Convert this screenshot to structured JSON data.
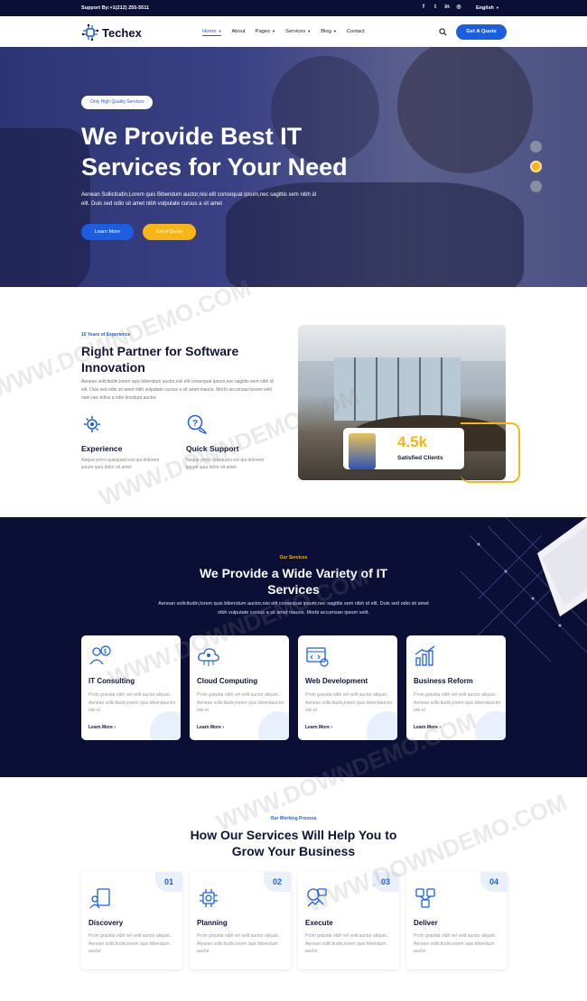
{
  "topbar": {
    "support": "Support By:+1(212) 255-5511",
    "social_icons": [
      "facebook-icon",
      "twitter-icon",
      "linkedin-icon",
      "instagram-icon"
    ],
    "language": "English"
  },
  "nav": {
    "logo_text": "Techex",
    "items": [
      {
        "label": "Home",
        "has_dropdown": true,
        "active": true
      },
      {
        "label": "About",
        "has_dropdown": false
      },
      {
        "label": "Pages",
        "has_dropdown": true
      },
      {
        "label": "Services",
        "has_dropdown": true
      },
      {
        "label": "Blog",
        "has_dropdown": true
      },
      {
        "label": "Contact",
        "has_dropdown": false
      }
    ],
    "cta": "Get A Quote"
  },
  "hero": {
    "badge": "Only High Quality Services",
    "title": "We Provide Best IT Services for Your Need",
    "text": "Aenean Sollicitudin,Lorem quis Bibendum auctor,nisi elit consequat ipsum,nec sagittis sem nibh id elit. Duis sed odio sit amet nibh vulputate cursus a sit amet",
    "btn_learn": "Learn More",
    "btn_quote": "Get A Quote",
    "slide_count": 3,
    "active_slide": 2
  },
  "about": {
    "tag": "15 Years of Experience",
    "title": "Right Partner for Software Innovation",
    "text": "Aenean solicitudin,lorem quis bibendum auctor,nisi elit consequat ipsum,nec sagittis sem nibh id elit. Duis sed odio sit amet nibh vulputate cursus a sit amet mauris. Morbi accumsan ipsum velit nam nec tellus a odio tincidunt auctor.",
    "features": [
      {
        "title": "Experience",
        "text": "Neque porro quisquam est qui dolorem ipsum quia dolor sit amet"
      },
      {
        "title": "Quick Support",
        "text": "Neque porro quisquam est qui dolorem ipsum quia dolor sit amet"
      }
    ],
    "clients_number": "4.5k",
    "clients_label": "Satisfied Clients"
  },
  "services": {
    "tag": "Our Services",
    "title": "We Provide a Wide Variety of IT Services",
    "subtitle": "Aenean solicitudin,lorem quis bibendum auctor,nisi elit consequat ipsum,nec sagittis sem nibh id elit. Duis sed odio sit amet nibh vulputate cursus a sit amet mauris. Morbi accumsan ipsum velit.",
    "cards": [
      {
        "title": "IT Consulting",
        "text": "Proin gravida nibh vel velit auctor aliquet. Aenean sollicitudin,lorem quis bibendauctor nisi el.",
        "more": "Learn More"
      },
      {
        "title": "Cloud Computing",
        "text": "Proin gravida nibh vel velit auctor aliquet. Aenean sollicitudin,lorem quis bibendauctor nisi el.",
        "more": "Learn More"
      },
      {
        "title": "Web Development",
        "text": "Proin gravida nibh vel velit auctor aliquet. Aenean sollicitudin,lorem quis bibendauctor nisi el.",
        "more": "Learn More"
      },
      {
        "title": "Business Reform",
        "text": "Proin gravida nibh vel velit auctor aliquet. Aenean sollicitudin,lorem quis bibendauctor nisi el.",
        "more": "Learn More"
      }
    ]
  },
  "process": {
    "tag": "Our Working Process",
    "title": "How Our Services Will Help You to Grow Your Business",
    "steps": [
      {
        "num": "01",
        "title": "Discovery",
        "text": "Proin gravida nibh vel velit auctor aliquet. Aenean sollicitudin,lorem quis bibendum auctor."
      },
      {
        "num": "02",
        "title": "Planning",
        "text": "Proin gravida nibh vel velit auctor aliquet. Aenean sollicitudin,lorem quis bibendum auctor."
      },
      {
        "num": "03",
        "title": "Execute",
        "text": "Proin gravida nibh vel velit auctor aliquet. Aenean sollicitudin,lorem quis bibendum auctor."
      },
      {
        "num": "04",
        "title": "Deliver",
        "text": "Proin gravida nibh vel velit auctor aliquet. Aenean sollicitudin,lorem quis bibendum auctor."
      }
    ]
  },
  "watermark": "WWW.DOWNDEMO.COM",
  "colors": {
    "primary": "#1b5fe0",
    "accent": "#f7b614",
    "dark": "#0c0f35"
  }
}
